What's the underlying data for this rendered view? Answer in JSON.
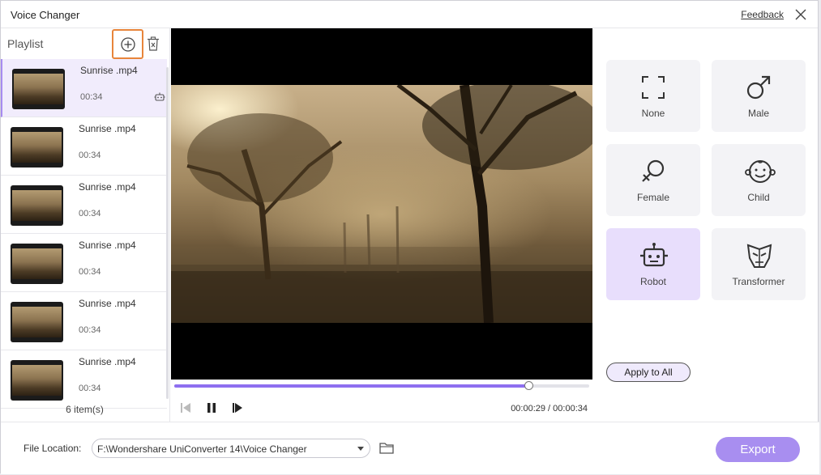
{
  "window": {
    "title": "Voice Changer",
    "feedback_label": "Feedback"
  },
  "playlist": {
    "title": "Playlist",
    "items": [
      {
        "name": "Sunrise .mp4",
        "duration": "00:34"
      },
      {
        "name": "Sunrise .mp4",
        "duration": "00:34"
      },
      {
        "name": "Sunrise .mp4",
        "duration": "00:34"
      },
      {
        "name": "Sunrise .mp4",
        "duration": "00:34"
      },
      {
        "name": "Sunrise .mp4",
        "duration": "00:34"
      },
      {
        "name": "Sunrise .mp4",
        "duration": "00:34"
      }
    ],
    "count_label": "6 item(s)"
  },
  "player": {
    "progress": 0.853,
    "time": "00:00:29 / 00:00:34"
  },
  "effects": {
    "none": "None",
    "male": "Male",
    "female": "Female",
    "child": "Child",
    "robot": "Robot",
    "transformer": "Transformer",
    "selected": "Robot",
    "apply_all_label": "Apply to All"
  },
  "footer": {
    "file_location_label": "File Location:",
    "file_path": "F:\\Wondershare UniConverter 14\\Voice Changer",
    "export_label": "Export"
  },
  "colors": {
    "accent": "#a88ef0",
    "highlight": "#e8853b",
    "selected_bg": "#e8defc"
  }
}
